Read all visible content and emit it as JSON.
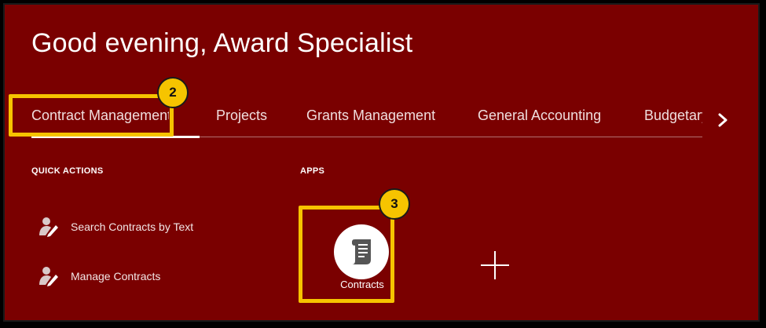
{
  "header": {
    "greeting": "Good evening, Award Specialist"
  },
  "tabs": [
    {
      "label": "Contract Management",
      "active": true
    },
    {
      "label": "Projects"
    },
    {
      "label": "Grants Management"
    },
    {
      "label": "General Accounting"
    },
    {
      "label": "Budgetary Control"
    }
  ],
  "quick_actions": {
    "title": "QUICK ACTIONS",
    "items": [
      {
        "label": "Search Contracts by Text",
        "icon": "user-edit-icon"
      },
      {
        "label": "Manage Contracts",
        "icon": "user-edit-icon"
      }
    ]
  },
  "apps": {
    "title": "APPS",
    "items": [
      {
        "label": "Contracts",
        "icon": "scroll-document-icon"
      }
    ],
    "add_icon": "plus-icon"
  },
  "annotations": [
    {
      "number": "2",
      "target": "Contract Management tab"
    },
    {
      "number": "3",
      "target": "Contracts app tile"
    }
  ],
  "colors": {
    "background": "#7a0000",
    "highlight": "#f6c400",
    "text": "#ffffff"
  }
}
